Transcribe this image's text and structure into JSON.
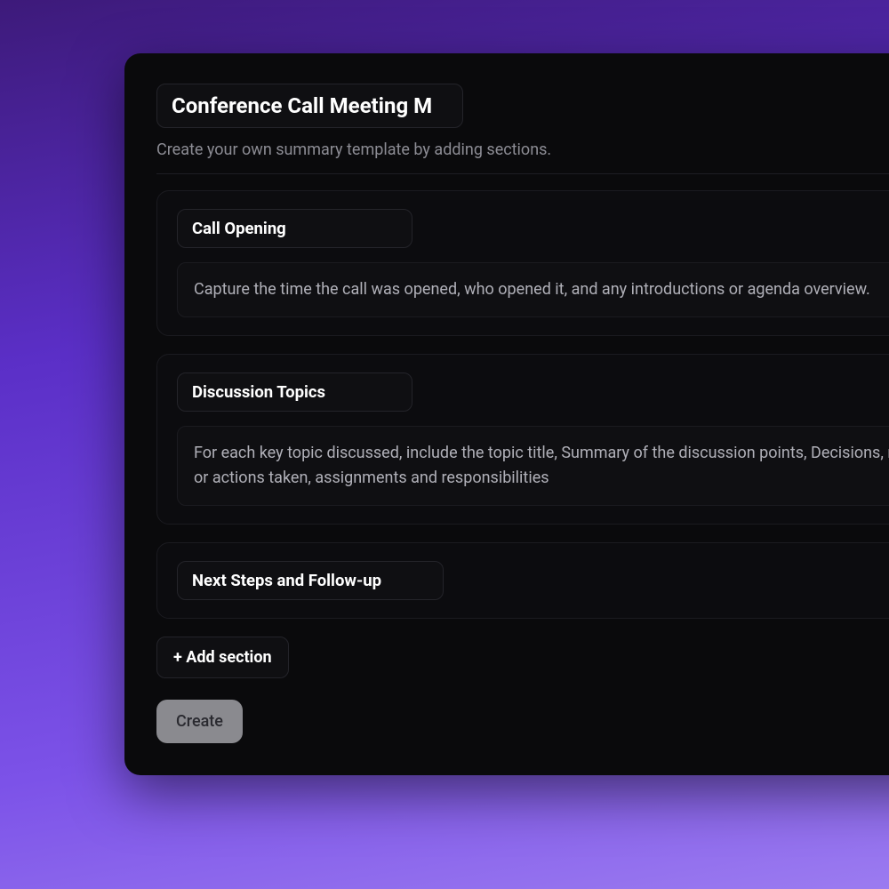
{
  "template": {
    "title": "Conference Call Meeting M",
    "subtitle": "Create your own summary template by adding sections."
  },
  "sections": [
    {
      "title": "Call Opening",
      "description": "Capture the time the call was opened, who opened it, and any introductions or agenda overview."
    },
    {
      "title": "Discussion Topics",
      "description": "For each key topic discussed, include the topic title, Summary of the discussion points, Decisions, made, or actions taken, assignments and responsibilities"
    },
    {
      "title": "Next Steps and Follow-up",
      "description": ""
    }
  ],
  "buttons": {
    "add_section": "+ Add section",
    "create": "Create"
  }
}
